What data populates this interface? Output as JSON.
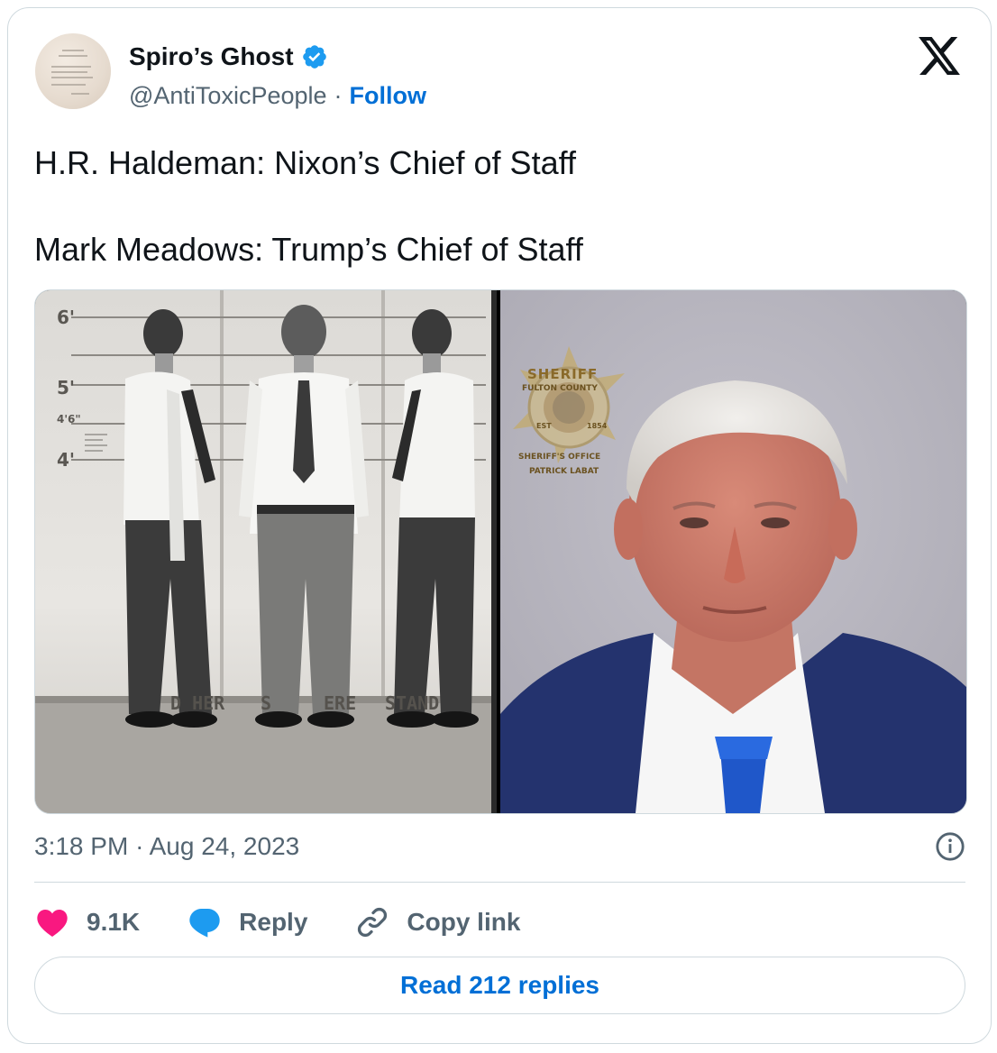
{
  "author": {
    "display_name": "Spiro’s Ghost",
    "handle": "@AntiToxicPeople",
    "separator": "·",
    "follow_label": "Follow",
    "verified_icon": "verified-badge-icon"
  },
  "tweet": {
    "lines": [
      "H.R. Haldeman: Nixon’s Chief of Staff",
      "Mark Meadows: Trump’s Chief of Staff"
    ]
  },
  "media": {
    "left_photo": {
      "height_marks": [
        "6'",
        "5'",
        "4'6\"",
        "4'"
      ],
      "floor_text": [
        "D HER",
        "S",
        "ERE",
        "STAND"
      ]
    },
    "right_photo": {
      "badge_top": "SHERIFF",
      "badge_county": "FULTON COUNTY",
      "badge_left": "EST",
      "badge_right": "1854",
      "badge_office": "SHERIFF'S OFFICE",
      "badge_name": "PATRICK LABAT"
    }
  },
  "meta": {
    "time": "3:18 PM",
    "separator": "·",
    "date": "Aug 24, 2023"
  },
  "actions": {
    "likes": "9.1K",
    "reply_label": "Reply",
    "copy_label": "Copy link"
  },
  "read_replies_label": "Read 212 replies",
  "colors": {
    "link_blue": "#006fd6",
    "verified_blue": "#1d9bf0",
    "like_pink": "#f91880",
    "text_gray": "#536471",
    "border": "#cfd9de"
  }
}
